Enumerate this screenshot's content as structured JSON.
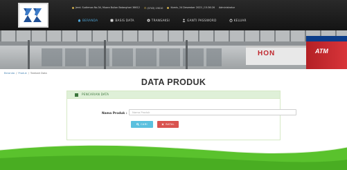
{
  "header": {
    "infobar": {
      "address": "Jend. Sudirman No.34, Muara Bulian Batanghari 36612",
      "phone": "(0743) 19010",
      "datetime": "Kamis, 24 Desember 2023 | 15:36:26",
      "user": "Administrator"
    },
    "nav": {
      "items": [
        {
          "label": "BERANDA",
          "icon": "home-icon",
          "active": true
        },
        {
          "label": "BASIS DATA",
          "icon": "database-icon",
          "active": false
        },
        {
          "label": "TRANSAKSI",
          "icon": "transaction-icon",
          "active": false
        },
        {
          "label": "GANTI PASSWORD",
          "icon": "user-icon",
          "active": false
        },
        {
          "label": "KELUAR",
          "icon": "logout-icon",
          "active": false
        }
      ]
    }
  },
  "banner": {
    "sign_text": "HON",
    "atm_text": "ATM"
  },
  "breadcrumb": {
    "items": [
      "Beranda",
      "Produk",
      "Tambah Data"
    ]
  },
  "page": {
    "title": "DATA PRODUK"
  },
  "panel": {
    "title": "PENCARIAN DATA",
    "form": {
      "label": "Nama Produk :",
      "placeholder": "Nama Produk",
      "value": ""
    },
    "buttons": {
      "search": "CARI",
      "reset": "BATAL"
    }
  },
  "colors": {
    "header_bg": "#1c1c1c",
    "nav_active": "#4ea6d9",
    "panel_head": "#dff0d8",
    "panel_text": "#3c763d",
    "search_btn": "#5bc0de",
    "reset_btn": "#d9534f",
    "footer_green": "#56c02b"
  }
}
